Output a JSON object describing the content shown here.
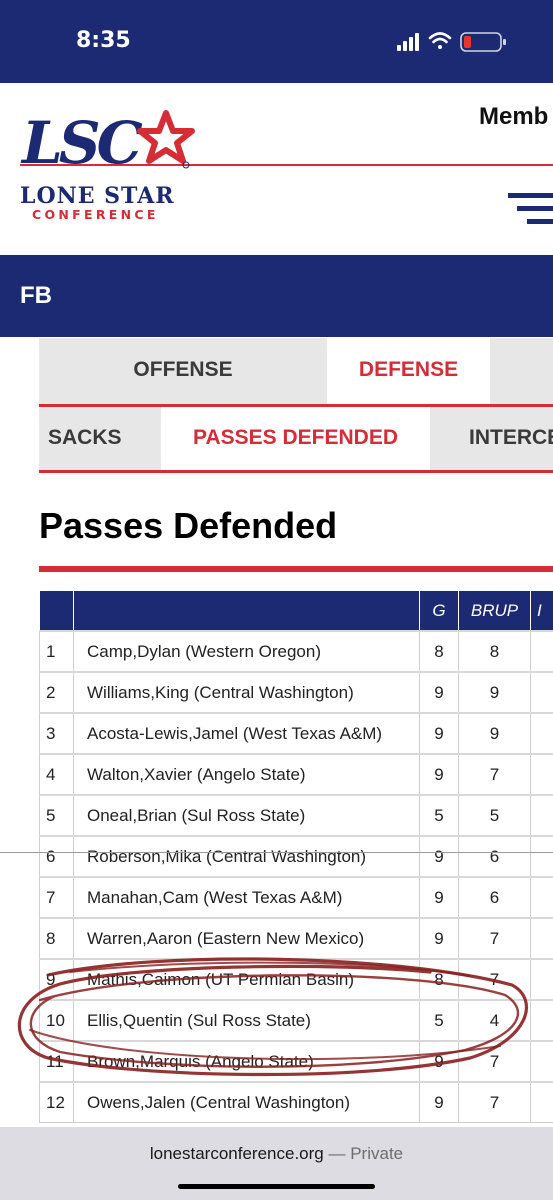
{
  "status_bar": {
    "time": "8:35",
    "icons": [
      "cellular-signal-icon",
      "wifi-icon",
      "battery-low-icon"
    ],
    "battery_color": "#e8322c"
  },
  "header": {
    "logo_mark": "LSC",
    "logo_line1": "LONE STAR",
    "logo_line2": "CONFERENCE",
    "member_link": "Memb",
    "menu_icon": "hamburger-menu-icon"
  },
  "sport_bar": {
    "label": "FB"
  },
  "tabs_primary": [
    {
      "label": "OFFENSE",
      "active": false
    },
    {
      "label": "DEFENSE",
      "active": true
    }
  ],
  "tabs_secondary": [
    {
      "label": "SACKS",
      "active": false
    },
    {
      "label": "PASSES DEFENDED",
      "active": true
    },
    {
      "label": "INTERCE",
      "active": false
    }
  ],
  "page_title": "Passes Defended",
  "table": {
    "columns": [
      "",
      "",
      "G",
      "BRUP",
      "I"
    ],
    "rows": [
      {
        "rank": "1",
        "name": "Camp,Dylan (Western Oregon)",
        "g": "8",
        "brup": "8"
      },
      {
        "rank": "2",
        "name": "Williams,King (Central Washington)",
        "g": "9",
        "brup": "9"
      },
      {
        "rank": "3",
        "name": "Acosta-Lewis,Jamel (West Texas A&M)",
        "g": "9",
        "brup": "9"
      },
      {
        "rank": "4",
        "name": "Walton,Xavier (Angelo State)",
        "g": "9",
        "brup": "7"
      },
      {
        "rank": "5",
        "name": "Oneal,Brian (Sul Ross State)",
        "g": "5",
        "brup": "5"
      },
      {
        "rank": "6",
        "name": "Roberson,Mika (Central Washington)",
        "g": "9",
        "brup": "6"
      },
      {
        "rank": "7",
        "name": "Manahan,Cam (West Texas A&M)",
        "g": "9",
        "brup": "6"
      },
      {
        "rank": "8",
        "name": "Warren,Aaron (Eastern New Mexico)",
        "g": "9",
        "brup": "7"
      },
      {
        "rank": "9",
        "name": "Mathis,Caimon (UT Permian Basin)",
        "g": "8",
        "brup": "7"
      },
      {
        "rank": "10",
        "name": "Ellis,Quentin (Sul Ross State)",
        "g": "5",
        "brup": "4"
      },
      {
        "rank": "11",
        "name": "Brown,Marquis (Angelo State)",
        "g": "9",
        "brup": "7"
      },
      {
        "rank": "12",
        "name": "Owens,Jalen (Central Washington)",
        "g": "9",
        "brup": "7"
      }
    ]
  },
  "browser": {
    "url": "lonestarconference.org",
    "separator": "—",
    "mode": "Private"
  },
  "colors": {
    "navy": "#1c2973",
    "red": "#d62c35",
    "tab_gray": "#e7e7e7",
    "annotation": "#8a1e1e"
  }
}
